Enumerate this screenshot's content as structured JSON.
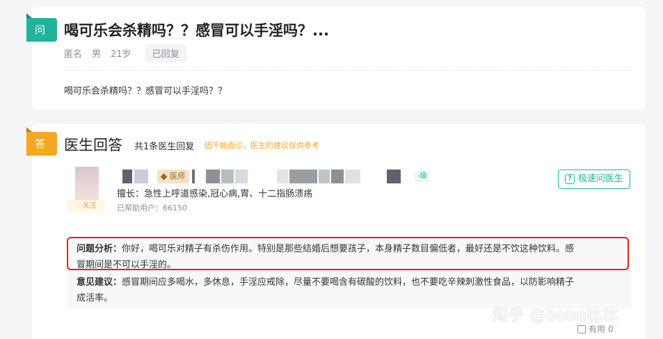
{
  "question": {
    "tag": "问",
    "title": "喝可乐会杀精吗？？感冒可以手淫吗？...",
    "author": "匿名",
    "gender": "男",
    "age": "21岁",
    "status": "已回复",
    "body": "喝可乐会杀精吗？？感冒可以手淫吗？？"
  },
  "answers": {
    "tag": "答",
    "title": "医生回答",
    "count": "共1条医生回复",
    "notice": "因不能面诊，医生的建议仅供参考"
  },
  "doctor": {
    "follow_label": "关注",
    "badge": "医师",
    "level": "-级",
    "specialty": "擅长：急性上呼道感染,冠心病,胃、十二指肠溃疡",
    "helped": "已帮助用户：66150",
    "ask_button": "极速问医生",
    "ask_icon": "?"
  },
  "reply": {
    "analysis_label": "问题分析：",
    "analysis_line1": "你好，喝可乐对精子有杀伤作用。特别是那些结婚后想要孩子，本身精子数目偏低者，最好还是不饮这种饮料。感",
    "analysis_line2": "冒期间是不可以手淫的。",
    "advice_label": "意见建议：",
    "advice_line1": "感冒期间应多喝水，多休息，手淫应戒除，尽量不要喝含有碳酸的饮料，也不要吃辛辣刺激性食品，以防影响精子",
    "advice_line2": "成活率。"
  },
  "watermark": "知乎 @bobo比比",
  "useful": {
    "label": "有用",
    "count": "0"
  },
  "colors": {
    "accent_green": "#22b39a",
    "accent_orange": "#f5a623",
    "highlight_red": "#e0241b"
  }
}
